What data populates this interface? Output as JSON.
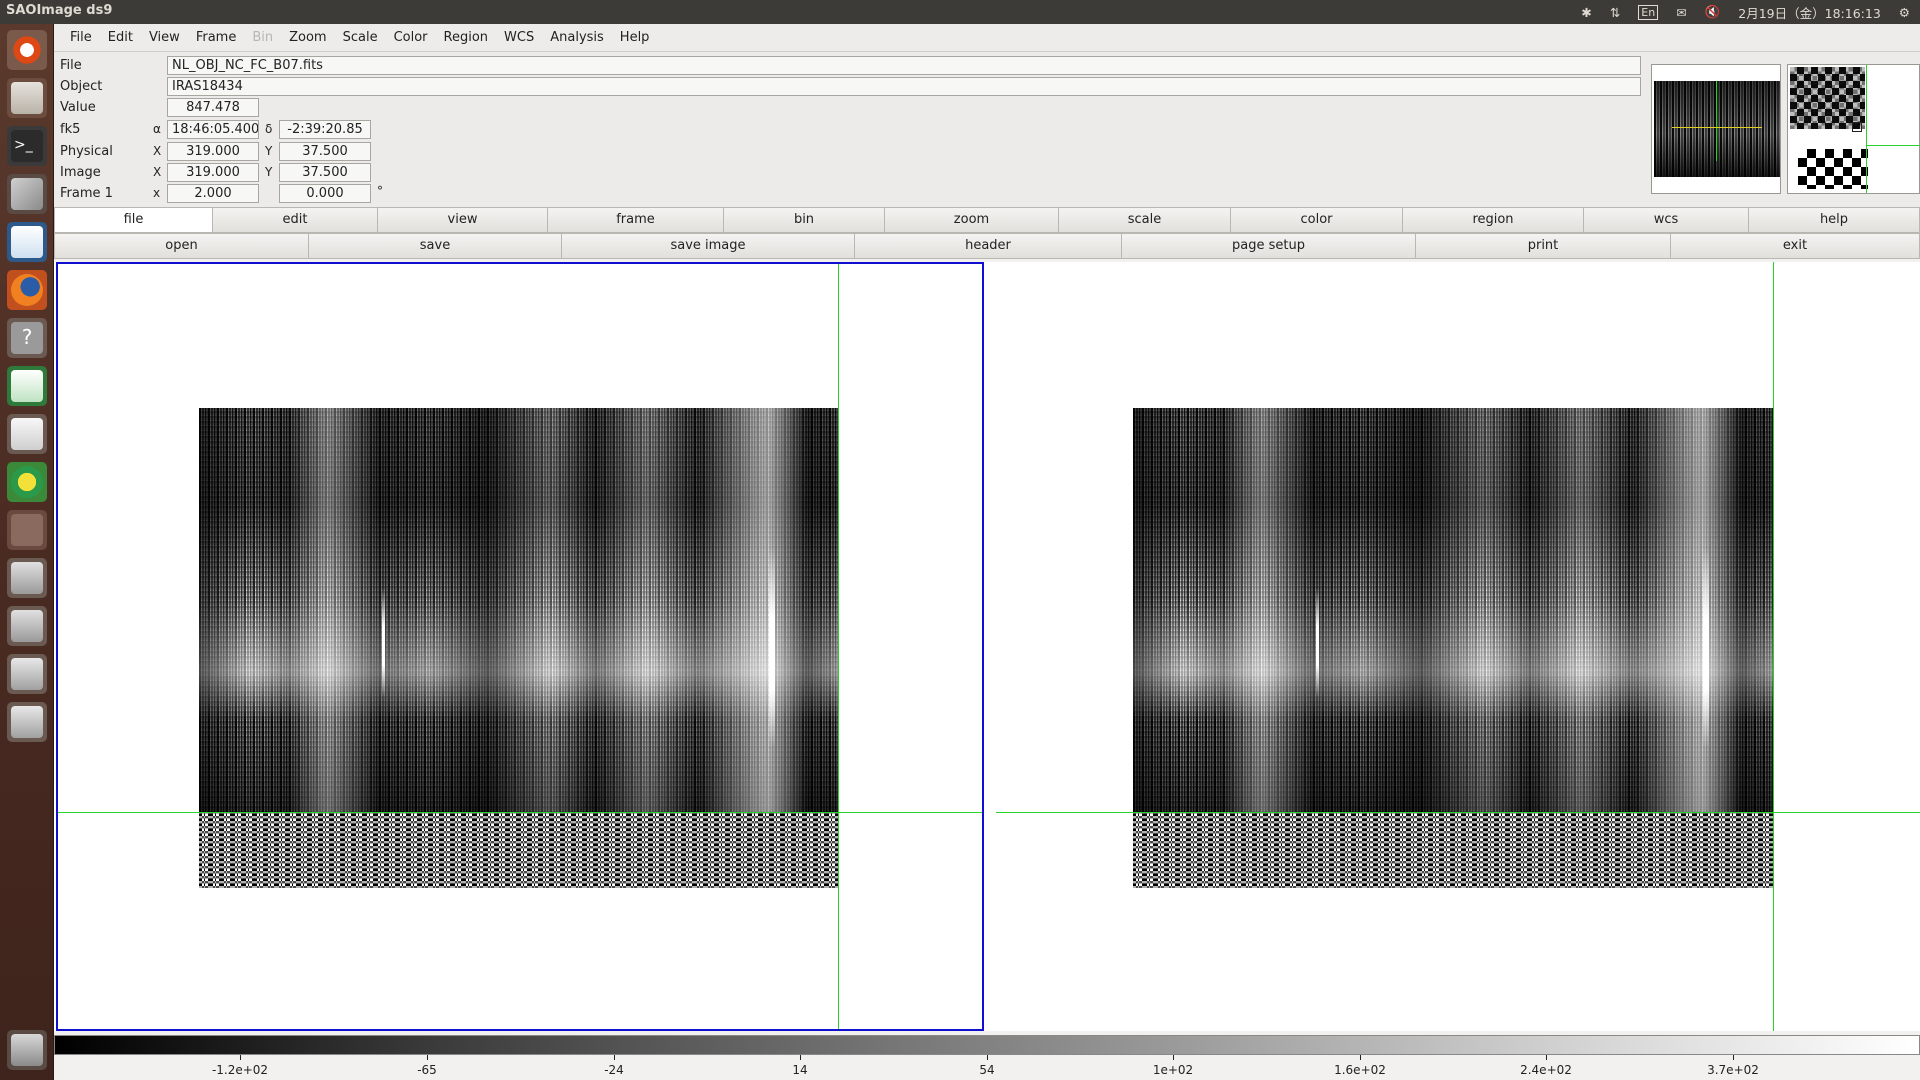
{
  "window": {
    "title": "SAOImage ds9"
  },
  "tray": {
    "keyboard": "En",
    "date": "2月19日（金）18:16:13"
  },
  "menu": [
    "File",
    "Edit",
    "View",
    "Frame",
    "Bin",
    "Zoom",
    "Scale",
    "Color",
    "Region",
    "WCS",
    "Analysis",
    "Help"
  ],
  "menu_disabled": [
    "Bin"
  ],
  "info": {
    "file_label": "File",
    "file_value": "NL_OBJ_NC_FC_B07.fits",
    "object_label": "Object",
    "object_value": "IRAS18434",
    "value_label": "Value",
    "value_value": "847.478",
    "fk5_label": "fk5",
    "alpha_sym": "α",
    "alpha_value": "18:46:05.400",
    "delta_sym": "δ",
    "delta_value": "-2:39:20.85",
    "physical_label": "Physical",
    "physical_x_sym": "X",
    "physical_x": "319.000",
    "physical_y_sym": "Y",
    "physical_y": "37.500",
    "image_label": "Image",
    "image_x_sym": "X",
    "image_x": "319.000",
    "image_y_sym": "Y",
    "image_y": "37.500",
    "frame_label": "Frame 1",
    "frame_x_sym": "x",
    "frame_zoom": "2.000",
    "frame_angle": "0.000",
    "degree_sym": "°"
  },
  "buttons_main": [
    "file",
    "edit",
    "view",
    "frame",
    "bin",
    "zoom",
    "scale",
    "color",
    "region",
    "wcs",
    "help"
  ],
  "buttons_file": [
    "open",
    "save",
    "save image",
    "header",
    "page setup",
    "print",
    "exit"
  ],
  "colorbar": {
    "ticks": [
      "-1.2e+02",
      "-65",
      "-24",
      "14",
      "54",
      "1e+02",
      "1.6e+02",
      "2.4e+02",
      "3.7e+02"
    ]
  },
  "colors": {
    "crosshair": "#2ad32a",
    "active_frame": "#1010d0"
  }
}
